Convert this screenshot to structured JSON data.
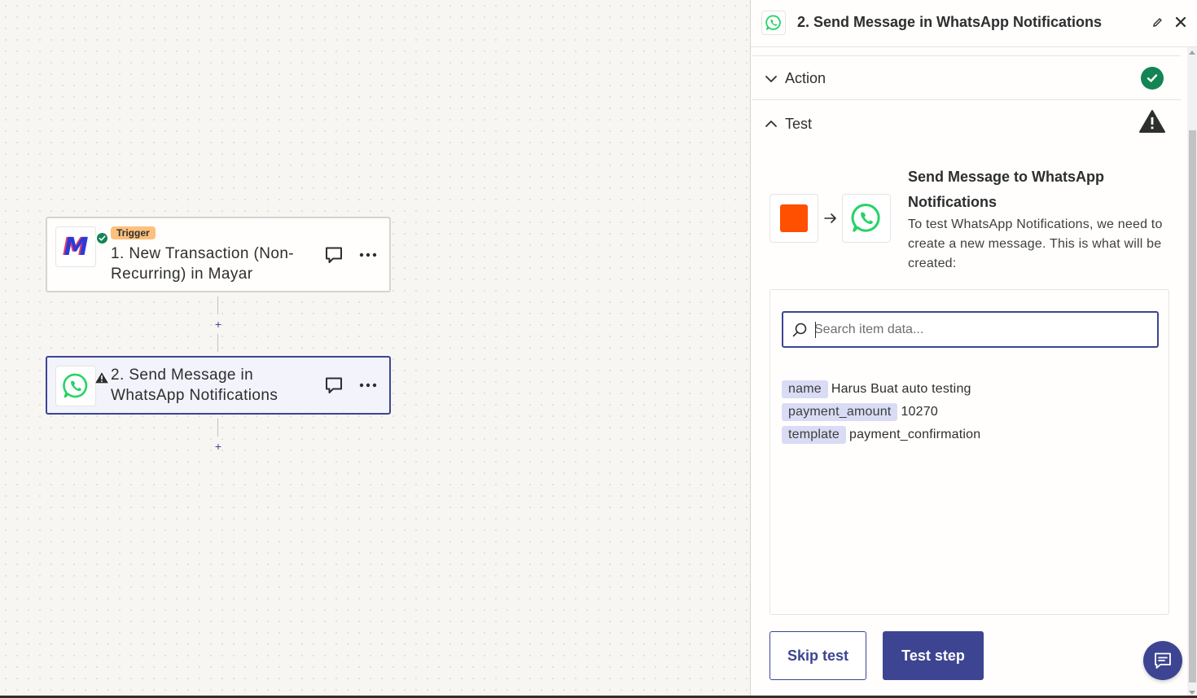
{
  "canvas": {
    "trigger_step": {
      "tag": "Trigger",
      "title": "1. New Transaction (Non-Recurring) in Mayar",
      "app_logo_text": "M",
      "status": "ok"
    },
    "action_step": {
      "title": "2. Send Message in WhatsApp Notifications",
      "status": "warning"
    },
    "add_step_symbol": "+"
  },
  "panel": {
    "title": "2. Send Message in WhatsApp Notifications",
    "sections": {
      "action": {
        "label": "Action",
        "status": "complete"
      },
      "test": {
        "label": "Test",
        "status": "warning"
      }
    },
    "test": {
      "heading": "Send Message to WhatsApp Notifications",
      "description": "To test WhatsApp Notifications, we need to create a new message. This is what will be created:",
      "search": {
        "placeholder": "Search item data...",
        "value": ""
      },
      "fields": [
        {
          "key": "name",
          "value": "Harus Buat auto testing"
        },
        {
          "key": "payment_amount",
          "value": "10270"
        },
        {
          "key": "template",
          "value": "payment_confirmation"
        }
      ],
      "skip_label": "Skip test",
      "test_label": "Test step"
    }
  },
  "colors": {
    "primary": "#3d4592",
    "success": "#138453",
    "trigger_tag": "#fcc07c",
    "whatsapp": "#25d366",
    "zapier_orange": "#ff4f00"
  },
  "icons": [
    "mayar-logo",
    "whatsapp-icon",
    "check-icon",
    "warning-icon",
    "comment-icon",
    "more-icon",
    "pencil-icon",
    "close-icon",
    "chevron-down-icon",
    "chevron-up-icon",
    "arrow-right-icon",
    "search-icon",
    "chat-icon"
  ]
}
